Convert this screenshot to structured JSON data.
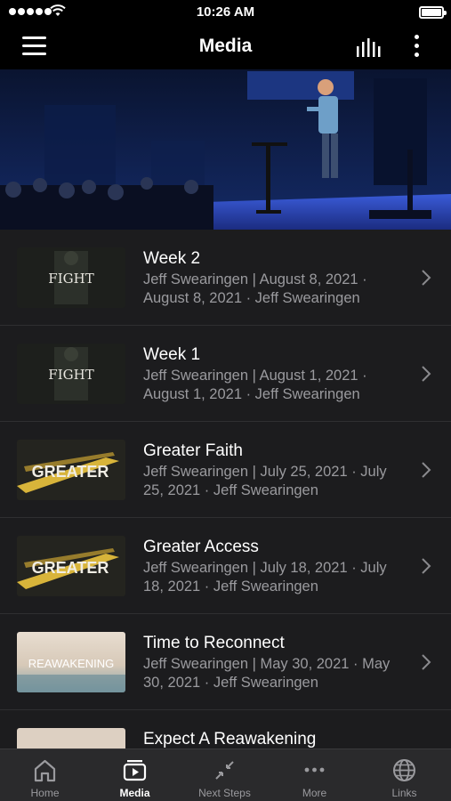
{
  "status_bar": {
    "time": "10:26 AM"
  },
  "nav": {
    "title": "Media"
  },
  "media_items": [
    {
      "title": "Week 2",
      "subtitle": "Jeff Swearingen | August 8, 2021 · August 8, 2021 · Jeff Swearingen",
      "thumb_text": "FIGHT"
    },
    {
      "title": "Week 1",
      "subtitle": "Jeff Swearingen | August 1, 2021 · August 1, 2021 · Jeff Swearingen",
      "thumb_text": "FIGHT"
    },
    {
      "title": "Greater Faith",
      "subtitle": "Jeff Swearingen | July 25, 2021 · July 25, 2021 · Jeff Swearingen",
      "thumb_text": "GREATER"
    },
    {
      "title": "Greater Access",
      "subtitle": "Jeff Swearingen | July 18, 2021 · July 18, 2021 · Jeff Swearingen",
      "thumb_text": "GREATER"
    },
    {
      "title": "Time to Reconnect",
      "subtitle": "Jeff Swearingen | May 30, 2021 · May 30, 2021 · Jeff Swearingen",
      "thumb_text": "REAWAKENING"
    },
    {
      "title": "Expect A Reawakening",
      "subtitle": "",
      "thumb_text": ""
    }
  ],
  "tabs": [
    {
      "label": "Home",
      "icon": "home-icon"
    },
    {
      "label": "Media",
      "icon": "media-icon",
      "active": true
    },
    {
      "label": "Next Steps",
      "icon": "next-steps-icon"
    },
    {
      "label": "More",
      "icon": "more-dots-icon"
    },
    {
      "label": "Links",
      "icon": "globe-icon"
    }
  ],
  "colors": {
    "background": "#1c1c1e",
    "bar": "#000000",
    "tab_bar": "#2a2a2c",
    "subtitle": "#9a9a9e",
    "stage_light": "#3a5bd8"
  }
}
